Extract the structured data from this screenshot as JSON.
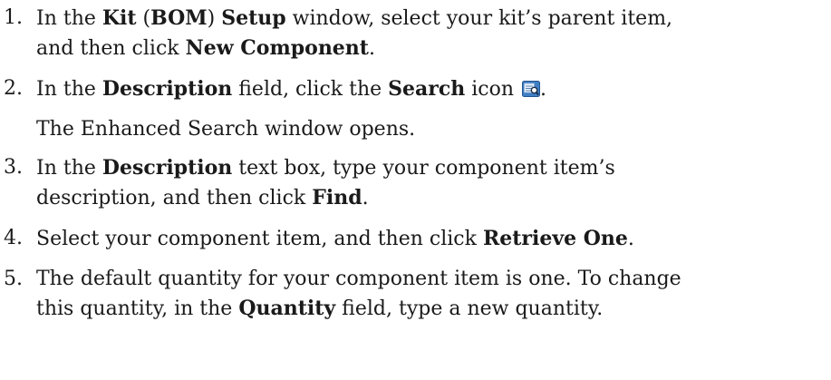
{
  "steps": [
    {
      "num": "1.",
      "segments_line1": [
        "In the ",
        "Kit",
        " (",
        "BOM",
        ") ",
        "Setup",
        " window, select your kit’s parent item,"
      ],
      "segments_line2": [
        "and then click ",
        "New Component",
        "."
      ]
    },
    {
      "num": "2.",
      "segments_line1": [
        "In the ",
        "Description",
        " field, click the ",
        "Search",
        " icon ",
        "."
      ],
      "icon": "search-icon",
      "note": "The Enhanced Search window opens."
    },
    {
      "num": "3.",
      "segments_line1": [
        "In the ",
        "Description",
        " text box, type your component item’s"
      ],
      "segments_line2": [
        "description, and then click ",
        "Find",
        "."
      ]
    },
    {
      "num": "4.",
      "segments_line1": [
        "Select your component item, and then click ",
        "Retrieve One",
        "."
      ]
    },
    {
      "num": "5.",
      "segments_line1": [
        "The default quantity for your component item is one. To change"
      ],
      "segments_line2": [
        "this quantity, in the ",
        "Quantity",
        " field, type a new quantity."
      ]
    }
  ],
  "colors": {
    "text": "#1a1a1a",
    "icon_blue": "#3f7fc4"
  }
}
